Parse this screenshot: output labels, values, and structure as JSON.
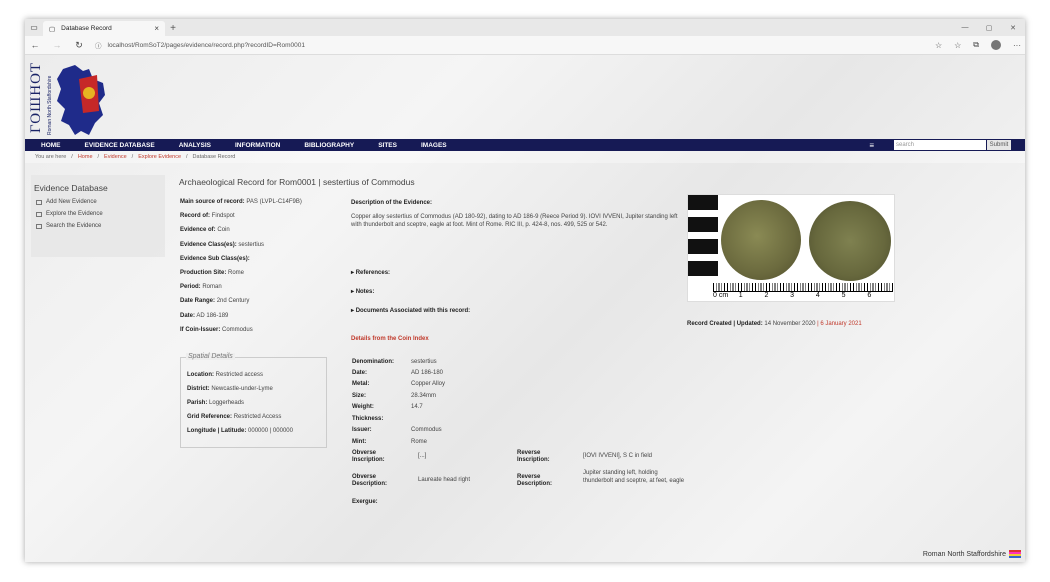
{
  "browser": {
    "tab_title": "Database Record",
    "url": "localhost/RomSoT2/pages/evidence/record.php?recordID=Rom0001"
  },
  "site": {
    "logo_title": "ГОШНОТ",
    "logo_subtitle": "Roman North Staffordshire"
  },
  "nav": {
    "items": [
      "HOME",
      "EVIDENCE DATABASE",
      "ANALYSIS",
      "INFORMATION",
      "BIBLIOGRAPHY",
      "SITES",
      "IMAGES"
    ],
    "search_placeholder": "search",
    "submit_label": "Submit"
  },
  "breadcrumb": {
    "prefix": "You are here",
    "items": [
      "Home",
      "Evidence",
      "Explore Evidence",
      "Database Record"
    ],
    "separator": "/"
  },
  "sidebar": {
    "title": "Evidence Database",
    "items": [
      "Add New Evidence",
      "Explore the Evidence",
      "Search the Evidence"
    ]
  },
  "main": {
    "title": "Archaeological Record for Rom0001 | sestertius of Commodus",
    "fields": [
      {
        "label": "Main source of record:",
        "value": "PAS (LVPL-C14F9B)"
      },
      {
        "label": "Record of:",
        "value": "Findspot"
      },
      {
        "label": "Evidence of:",
        "value": "Coin"
      },
      {
        "label": "Evidence Class(es):",
        "value": "sestertius"
      },
      {
        "label": "Evidence Sub Class(es):",
        "value": ""
      },
      {
        "label": "Production Site:",
        "value": "Rome"
      },
      {
        "label": "Period:",
        "value": "Roman"
      },
      {
        "label": "Date Range:",
        "value": "2nd Century"
      },
      {
        "label": "Date:",
        "value": "AD 186-189"
      },
      {
        "label": "If Coin-Issuer:",
        "value": "Commodus"
      }
    ],
    "spatial": {
      "legend": "Spatial Details",
      "rows": [
        {
          "label": "Location:",
          "value": "Restricted access"
        },
        {
          "label": "District:",
          "value": "Newcastle-under-Lyme"
        },
        {
          "label": "Parish:",
          "value": "Loggerheads"
        },
        {
          "label": "Grid Reference:",
          "value": "Restricted Access"
        },
        {
          "label": "Longitude | Latitude:",
          "value": "000000 | 000000"
        }
      ]
    },
    "description": {
      "heading": "Description of the Evidence:",
      "text": "Copper alloy sestertius of Commodus (AD 180-92), dating to AD 186-9 (Reece Period 9). IOVI IVVENI, Jupiter standing left with thunderbolt and sceptre, eagle at foot. Mint of Rome. RIC III, p. 424-8, nos. 499, 525 or 542."
    },
    "expanders": [
      "References:",
      "Notes:",
      "Documents Associated with this record:"
    ],
    "coin_index": {
      "heading": "Details from the Coin Index",
      "rows": [
        {
          "label": "Denomination:",
          "value": "sestertius"
        },
        {
          "label": "Date:",
          "value": "AD 186-180"
        },
        {
          "label": "Metal:",
          "value": "Copper Alloy"
        },
        {
          "label": "Size:",
          "value": "28.34mm"
        },
        {
          "label": "Weight:",
          "value": "14.7"
        },
        {
          "label": "Thickness:",
          "value": ""
        },
        {
          "label": "Issuer:",
          "value": "Commodus"
        },
        {
          "label": "Mint:",
          "value": "Rome"
        }
      ],
      "obverse_inscription_label": "Obverse Inscription:",
      "obverse_inscription": "[...]",
      "reverse_inscription_label": "Reverse Inscription:",
      "reverse_inscription": "[IOVI IVVENI], S C in field",
      "obverse_description_label": "Obverse Description:",
      "obverse_description": "Laureate head right",
      "reverse_description_label": "Reverse Description:",
      "reverse_description": "Jupiter standing left, holding thunderbolt and sceptre, at feet, eagle",
      "exergue_label": "Exergue:"
    },
    "image": {
      "ruler_labels": [
        "0 cm",
        "1",
        "2",
        "3",
        "4",
        "5",
        "6"
      ]
    },
    "record_dates": {
      "label": "Record Created | Updated:",
      "created": "14 November 2020",
      "separator": "|",
      "updated": "6 January 2021"
    }
  },
  "footer": {
    "text": "Roman North Staffordshire"
  }
}
